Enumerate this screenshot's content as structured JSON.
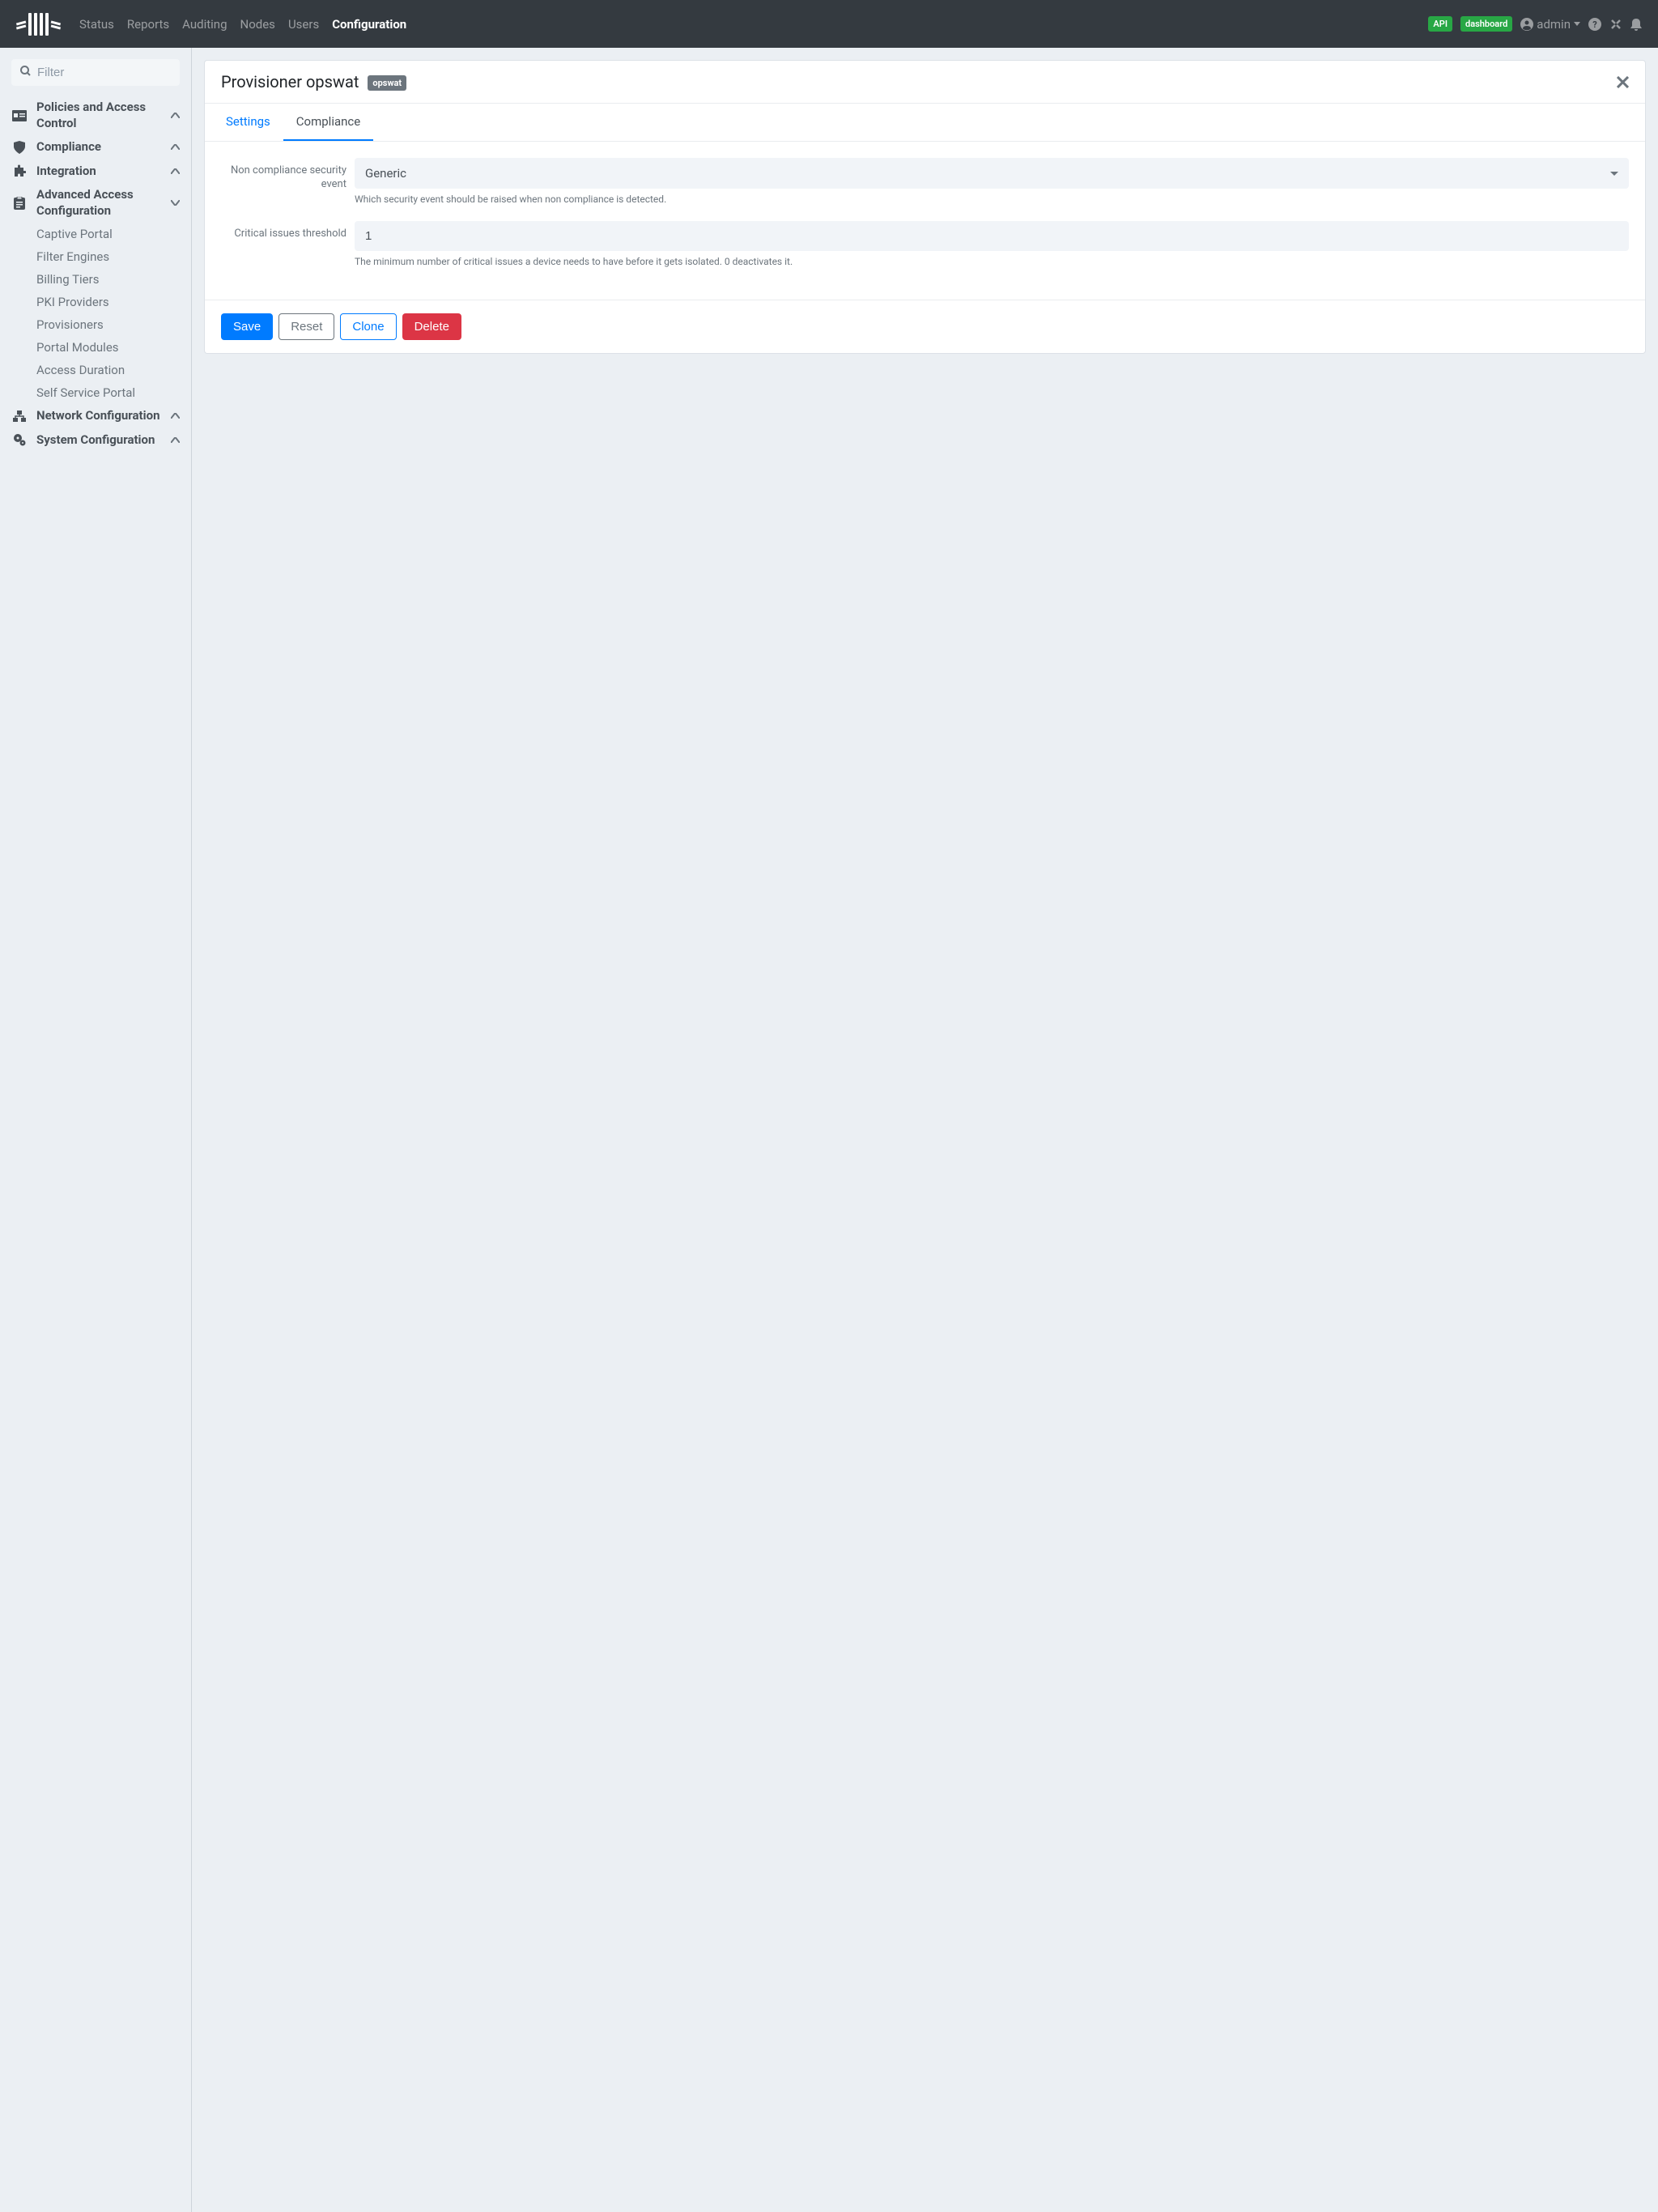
{
  "nav": {
    "items": [
      "Status",
      "Reports",
      "Auditing",
      "Nodes",
      "Users",
      "Configuration"
    ],
    "active_index": 5,
    "api_badge": "API",
    "dash_badge": "dashboard",
    "user": "admin"
  },
  "sidebar": {
    "filter_placeholder": "Filter",
    "sections": [
      {
        "label": "Policies and Access Control",
        "icon": "id-card"
      },
      {
        "label": "Compliance",
        "icon": "shield"
      },
      {
        "label": "Integration",
        "icon": "puzzle"
      },
      {
        "label": "Advanced Access Configuration",
        "icon": "clipboard",
        "expanded": true
      }
    ],
    "sub_items": [
      "Captive Portal",
      "Filter Engines",
      "Billing Tiers",
      "PKI Providers",
      "Provisioners",
      "Portal Modules",
      "Access Duration",
      "Self Service Portal"
    ],
    "bottom_sections": [
      {
        "label": "Network Configuration",
        "icon": "network"
      },
      {
        "label": "System Configuration",
        "icon": "cogs"
      }
    ]
  },
  "card": {
    "title_prefix": "Provisioner ",
    "title_name": "opswat",
    "badge": "opswat",
    "tabs": [
      "Settings",
      "Compliance"
    ],
    "active_tab": 1,
    "form": {
      "event_label": "Non compliance security event",
      "event_value": "Generic",
      "event_help": "Which security event should be raised when non compliance is detected.",
      "threshold_label": "Critical issues threshold",
      "threshold_value": "1",
      "threshold_help": "The minimum number of critical issues a device needs to have before it gets isolated. 0 deactivates it."
    },
    "buttons": {
      "save": "Save",
      "reset": "Reset",
      "clone": "Clone",
      "delete": "Delete"
    }
  }
}
